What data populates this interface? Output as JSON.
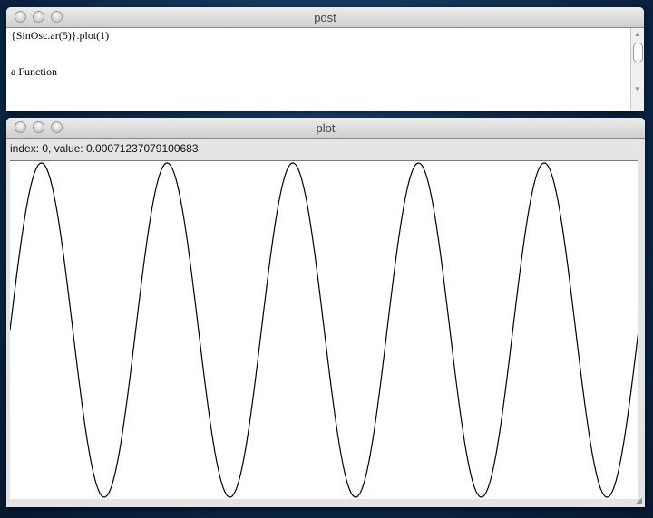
{
  "post_window": {
    "title": "post",
    "lines": [
      "{SinOsc.ar(5)}.plot(1)",
      "",
      "a Function"
    ]
  },
  "plot_window": {
    "title": "plot",
    "info": "index: 0, value: 0.00071237079100683"
  },
  "chart_data": {
    "type": "line",
    "function": "sin",
    "cycles": 5,
    "ylim": [
      -1,
      1
    ],
    "title": "",
    "xlabel": "",
    "ylabel": "",
    "grid": false
  }
}
